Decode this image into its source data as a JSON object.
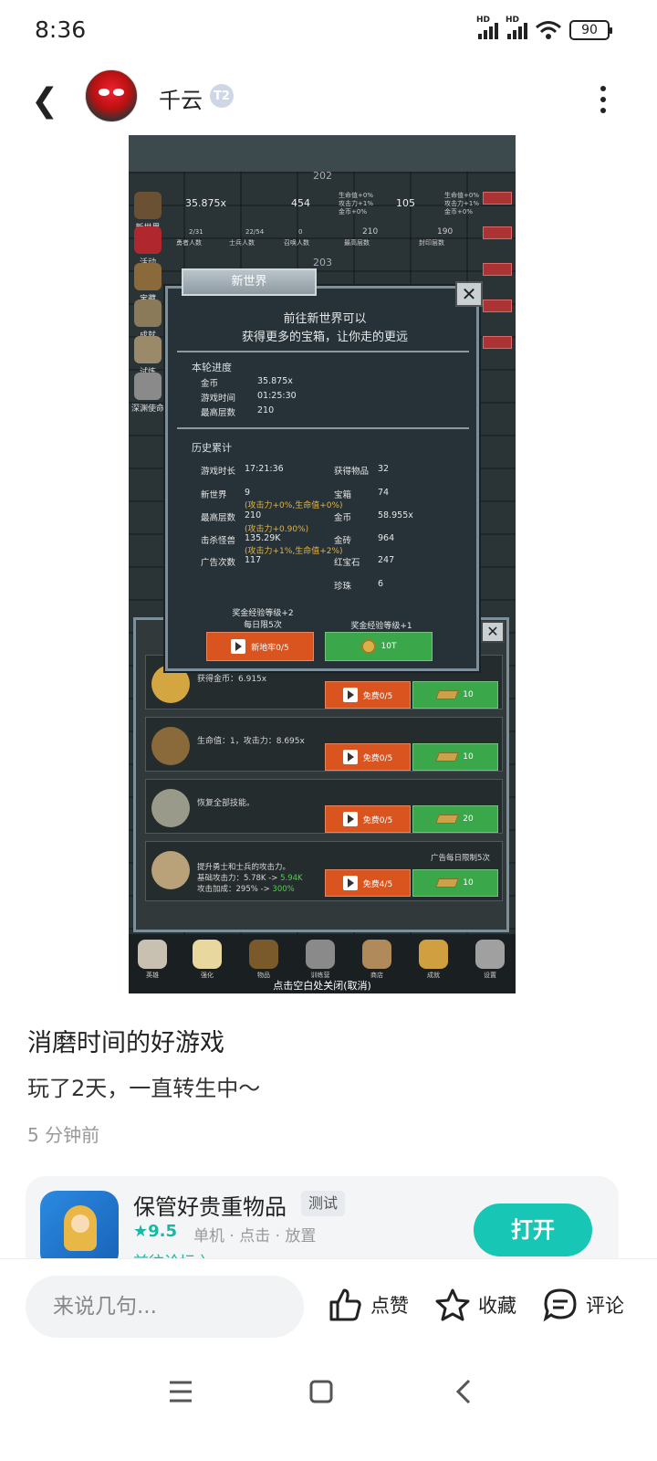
{
  "status": {
    "time": "8:36",
    "battery": "90",
    "hd1": "HD",
    "hd2": "HD"
  },
  "header": {
    "username": "千云",
    "badge": "T2"
  },
  "game": {
    "floor_top": "202",
    "floor_mid": "203",
    "gold": "35.875x",
    "bars": "454",
    "gems": "105",
    "hero_count": "2/31",
    "soldier_count": "22/54",
    "summon_count": "0",
    "max_floor": "210",
    "seal_floor": "190",
    "lbl_hero": "勇者人数",
    "lbl_soldier": "士兵人数",
    "lbl_summon": "召唤人数",
    "lbl_max": "最高层数",
    "lbl_seal": "封印层数",
    "mini1": "生命值+0%",
    "mini2": "攻击力+1%",
    "mini3": "金币+0%",
    "left_items": [
      "新世界",
      "活动",
      "宝藏",
      "成就",
      "试炼",
      "深渊使命"
    ],
    "dialog": {
      "tab": "新世界",
      "line1": "前往新世界可以",
      "line2": "获得更多的宝箱，让你走的更远",
      "sec1": "本轮进度",
      "k_gold": "金币",
      "v_gold": "35.875x",
      "k_time": "游戏时间",
      "v_time": "01:25:30",
      "k_floor": "最高层数",
      "v_floor": "210",
      "sec2": "历史累计",
      "k_playtime": "游戏时长",
      "v_playtime": "17:21:36",
      "k_items": "获得物品",
      "v_items": "32",
      "k_newworld": "新世界",
      "v_newworld": "9",
      "k_chest": "宝箱",
      "v_chest": "74",
      "bonus1": "(攻击力+0%,生命值+0%)",
      "k_maxfloor": "最高层数",
      "v_maxfloor": "210",
      "k_gold2": "金币",
      "v_gold2": "58.955x",
      "bonus2": "(攻击力+0.90%)",
      "k_kills": "击杀怪兽",
      "v_kills": "135.29K",
      "k_bricks": "金砖",
      "v_bricks": "964",
      "bonus3": "(攻击力+1%,生命值+2%)",
      "k_ads": "广告次数",
      "v_ads": "117",
      "k_ruby": "红宝石",
      "v_ruby": "247",
      "k_pearl": "珍珠",
      "v_pearl": "6",
      "foot1a": "奖金经验等级+2",
      "foot1b": "每日限5次",
      "foot2": "奖金经验等级+1",
      "btn1": "新地牢0/5",
      "btn2": "10T"
    },
    "panel": {
      "rows": [
        {
          "text": "获得金币：6.915x",
          "free": "免费0/5",
          "cost": "10"
        },
        {
          "text": "生命值：1，攻击力：8.695x",
          "free": "免费0/5",
          "cost": "10"
        },
        {
          "text": "恢复全部技能。",
          "free": "免费0/5",
          "cost": "20"
        },
        {
          "text1": "提升勇士和士兵的攻击力。",
          "text2": "基础攻击力：5.78K -> ",
          "text2b": "5.94K",
          "text3": "攻击加成：295% -> ",
          "text3b": "300%",
          "limit": "广告每日限制5次",
          "free": "免费4/5",
          "cost": "10"
        }
      ]
    },
    "tabs": [
      "英雄",
      "强化",
      "物品",
      "训练营",
      "商店",
      "成就",
      "设置"
    ],
    "close_hint": "点击空白处关闭(取消)"
  },
  "post": {
    "title": "消磨时间的好游戏",
    "body": "玩了2天，一直转生中～",
    "time": "5 分钟前"
  },
  "app": {
    "name": "保管好贵重物品",
    "tag": "测试",
    "score": "★9.5",
    "genre": "单机 · 点击 · 放置",
    "link": "前往论坛 〉",
    "open": "打开"
  },
  "bottom": {
    "placeholder": "来说几句...",
    "like": "点赞",
    "fav": "收藏",
    "comment": "评论"
  },
  "colors": {
    "accent": "#17c6b4",
    "orange_btn": "#d9541e",
    "green_btn": "#3aa84a"
  }
}
